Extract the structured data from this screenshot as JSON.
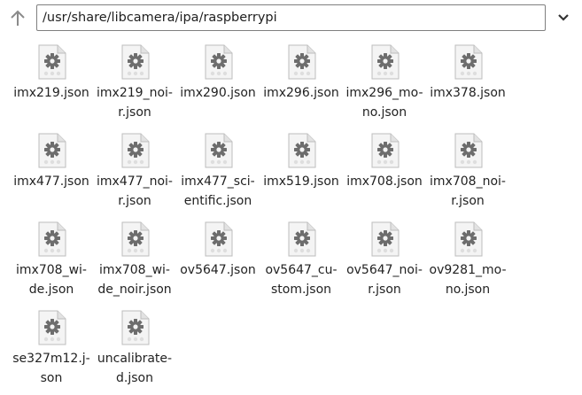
{
  "toolbar": {
    "up_icon": "arrow-up-icon",
    "path": "/usr/share/libcamera/ipa/raspberrypi",
    "dropdown_icon": "chevron-down-icon"
  },
  "files": [
    {
      "name": "imx219.json",
      "display": "imx219.json"
    },
    {
      "name": "imx219_noir.json",
      "display": "imx219_noi-\nr.json"
    },
    {
      "name": "imx290.json",
      "display": "imx290.json"
    },
    {
      "name": "imx296.json",
      "display": "imx296.json"
    },
    {
      "name": "imx296_mono.json",
      "display": "imx296_mo-\nno.json"
    },
    {
      "name": "imx378.json",
      "display": "imx378.json"
    },
    {
      "name": "imx477.json",
      "display": "imx477.json"
    },
    {
      "name": "imx477_noir.json",
      "display": "imx477_noi-\nr.json"
    },
    {
      "name": "imx477_scientific.json",
      "display": "imx477_sci-\nentific.json"
    },
    {
      "name": "imx519.json",
      "display": "imx519.json"
    },
    {
      "name": "imx708.json",
      "display": "imx708.json"
    },
    {
      "name": "imx708_noir.json",
      "display": "imx708_noi-\nr.json"
    },
    {
      "name": "imx708_wide.json",
      "display": "imx708_wi-\nde.json"
    },
    {
      "name": "imx708_wide_noir.json",
      "display": "imx708_wi-\nde_noir.json"
    },
    {
      "name": "ov5647.json",
      "display": "ov5647.json"
    },
    {
      "name": "ov5647_custom.json",
      "display": "ov5647_cu-\nstom.json"
    },
    {
      "name": "ov5647_noir.json",
      "display": "ov5647_noi-\nr.json"
    },
    {
      "name": "ov9281_mono.json",
      "display": "ov9281_mo-\nno.json"
    },
    {
      "name": "se327m12.json",
      "display": "se327m12.j-\nson"
    },
    {
      "name": "uncalibrated.json",
      "display": "uncalibrate-\nd.json"
    }
  ],
  "file_icon": "file-settings-icon"
}
